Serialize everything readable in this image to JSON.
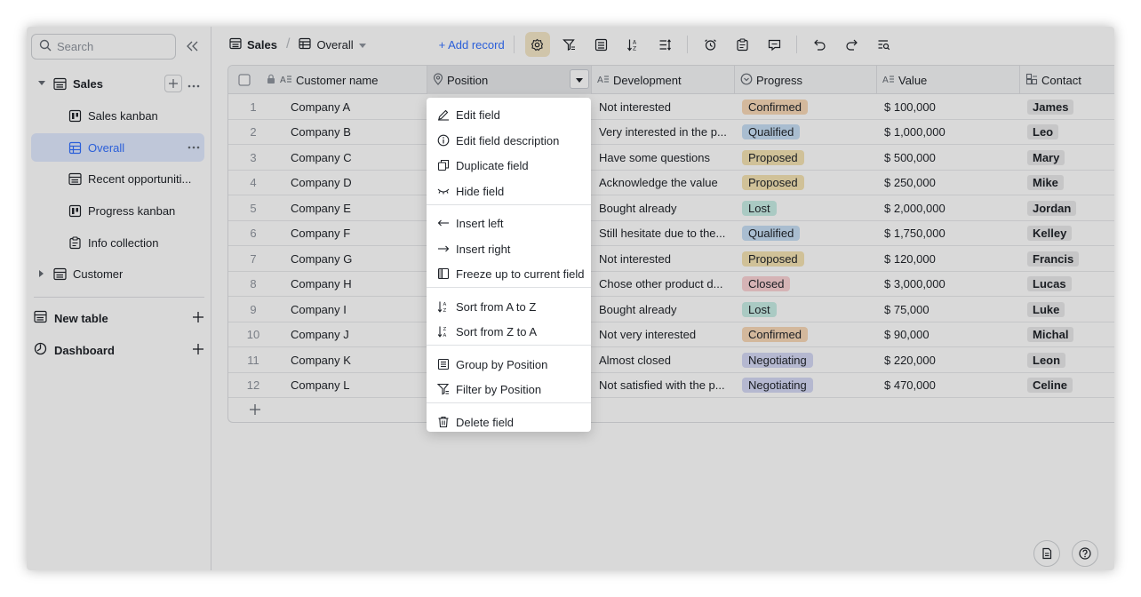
{
  "sidebar": {
    "search_placeholder": "Search",
    "tree": [
      {
        "label": "Sales",
        "level": 1,
        "expanded": true,
        "bold": true
      },
      {
        "label": "Sales kanban",
        "level": 2
      },
      {
        "label": "Overall",
        "level": 2,
        "active": true
      },
      {
        "label": "Recent opportuniti...",
        "level": 2
      },
      {
        "label": "Progress kanban",
        "level": 2
      },
      {
        "label": "Info collection",
        "level": 2
      },
      {
        "label": "Customer",
        "level": 1,
        "expanded": false
      }
    ],
    "new_table_label": "New table",
    "dashboard_label": "Dashboard"
  },
  "toolbar": {
    "crumb_base": "Sales",
    "crumb_view": "Overall",
    "add_record_label": "+ Add record",
    "icons": [
      "settings-icon",
      "filter-icon",
      "group-icon",
      "sort-icon",
      "row-height-icon",
      "alarm-icon",
      "form-icon",
      "comment-icon",
      "undo-icon",
      "redo-icon",
      "find-icon"
    ]
  },
  "grid": {
    "columns": [
      {
        "name": "Customer name",
        "icon": "text-field-icon"
      },
      {
        "name": "Position",
        "icon": "location-icon"
      },
      {
        "name": "Development",
        "icon": "text-field-icon"
      },
      {
        "name": "Progress",
        "icon": "single-select-icon"
      },
      {
        "name": "Value",
        "icon": "text-field-icon"
      },
      {
        "name": "Contact",
        "icon": "link-icon"
      }
    ],
    "rows": [
      {
        "n": "1",
        "customer": "Company A",
        "development": "Not interested",
        "progress": "Confirmed",
        "value": "$ 100,000",
        "contact": "James"
      },
      {
        "n": "2",
        "customer": "Company B",
        "development": "Very interested in the p...",
        "progress": "Qualified",
        "value": "$ 1,000,000",
        "contact": "Leo"
      },
      {
        "n": "3",
        "customer": "Company C",
        "development": "Have some questions",
        "progress": "Proposed",
        "value": "$ 500,000",
        "contact": "Mary"
      },
      {
        "n": "4",
        "customer": "Company D",
        "development": "Acknowledge the value",
        "progress": "Proposed",
        "value": "$ 250,000",
        "contact": "Mike"
      },
      {
        "n": "5",
        "customer": "Company E",
        "development": "Bought already",
        "progress": "Lost",
        "value": "$ 2,000,000",
        "contact": "Jordan"
      },
      {
        "n": "6",
        "customer": "Company F",
        "development": "Still hesitate due to the...",
        "progress": "Qualified",
        "value": "$ 1,750,000",
        "contact": "Kelley"
      },
      {
        "n": "7",
        "customer": "Company G",
        "development": "Not interested",
        "progress": "Proposed",
        "value": "$ 120,000",
        "contact": "Francis"
      },
      {
        "n": "8",
        "customer": "Company H",
        "development": "Chose other product d...",
        "progress": "Closed",
        "value": "$ 3,000,000",
        "contact": "Lucas"
      },
      {
        "n": "9",
        "customer": "Company I",
        "development": "Bought already",
        "progress": "Lost",
        "value": "$ 75,000",
        "contact": "Luke"
      },
      {
        "n": "10",
        "customer": "Company J",
        "development": "Not very interested",
        "progress": "Confirmed",
        "value": "$ 90,000",
        "contact": "Michal"
      },
      {
        "n": "11",
        "customer": "Company K",
        "development": "Almost closed",
        "progress": "Negotiating",
        "value": "$ 220,000",
        "contact": "Leon"
      },
      {
        "n": "12",
        "customer": "Company L",
        "development": "Not satisfied with the p...",
        "progress": "Negotiating",
        "value": "$ 470,000",
        "contact": "Celine"
      }
    ]
  },
  "progress_colors": {
    "Confirmed": "#f8d9b8",
    "Qualified": "#c7dff5",
    "Proposed": "#f5e3b3",
    "Lost": "#c8eee6",
    "Closed": "#fbd3d5",
    "Negotiating": "#d5d9f5"
  },
  "menu": {
    "groups": [
      [
        {
          "label": "Edit field",
          "icon": "pencil-icon"
        },
        {
          "label": "Edit field description",
          "icon": "info-icon"
        },
        {
          "label": "Duplicate field",
          "icon": "duplicate-icon"
        },
        {
          "label": "Hide field",
          "icon": "eye-closed-icon"
        }
      ],
      [
        {
          "label": "Insert left",
          "icon": "arrow-left-icon"
        },
        {
          "label": "Insert right",
          "icon": "arrow-right-icon"
        },
        {
          "label": "Freeze up to current field",
          "icon": "freeze-icon"
        }
      ],
      [
        {
          "label": "Sort from A to Z",
          "icon": "sort-az-icon"
        },
        {
          "label": "Sort from Z to A",
          "icon": "sort-za-icon"
        }
      ],
      [
        {
          "label": "Group by Position",
          "icon": "group-icon"
        },
        {
          "label": "Filter by Position",
          "icon": "filter-icon"
        }
      ],
      [
        {
          "label": "Delete field",
          "icon": "trash-icon"
        }
      ]
    ]
  },
  "corner_buttons": [
    "document-icon",
    "help-icon"
  ]
}
